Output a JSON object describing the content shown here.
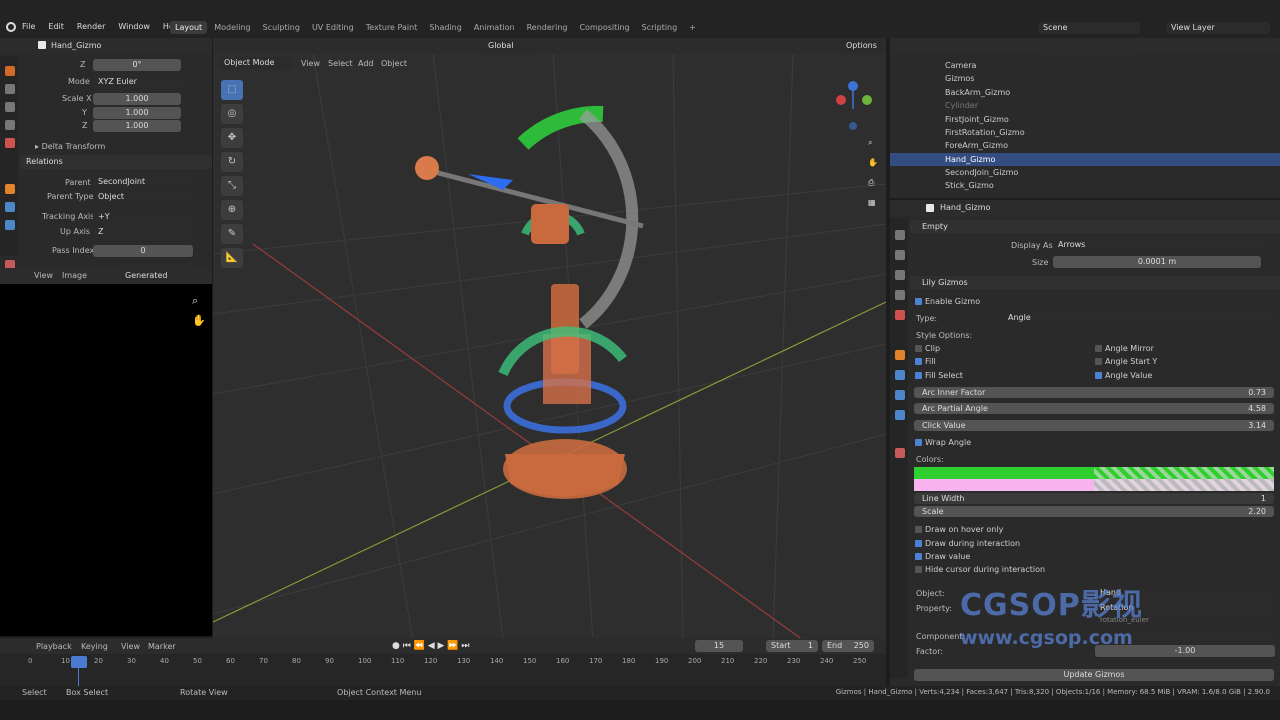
{
  "topbar": {
    "menus": [
      "File",
      "Edit",
      "Render",
      "Window",
      "Help"
    ],
    "workspaces": [
      "Layout",
      "Modeling",
      "Sculpting",
      "UV Editing",
      "Texture Paint",
      "Shading",
      "Animation",
      "Rendering",
      "Compositing",
      "Scripting"
    ],
    "scene": "Scene",
    "view_layer": "View Layer"
  },
  "props_left": {
    "object_name": "Hand_Gizmo",
    "z_rot": "0°",
    "mode_label": "Mode",
    "mode": "XYZ Euler",
    "scale_x_label": "Scale X",
    "scale_x": "1.000",
    "y_label": "Y",
    "scale_y": "1.000",
    "z_label": "Z",
    "scale_z": "1.000",
    "delta": "Delta Transform",
    "relations": "Relations",
    "parent_label": "Parent",
    "parent": "SecondJoint",
    "parent_type_label": "Parent Type",
    "parent_type": "Object",
    "tracking_label": "Tracking Axis",
    "tracking": "+Y",
    "up_label": "Up Axis",
    "up": "Z",
    "pass_label": "Pass Index",
    "pass": "0"
  },
  "image_editor": {
    "view": "View",
    "image": "Image",
    "name": "Generated Image"
  },
  "viewport": {
    "mode": "Object Mode",
    "menus": [
      "View",
      "Select",
      "Add",
      "Object"
    ],
    "orientation": "Global",
    "options": "Options"
  },
  "outliner": {
    "items": [
      "Camera",
      "Gizmos",
      "BackArm_Gizmo",
      "Cylinder",
      "FirstJoint_Gizmo",
      "FirstRotation_Gizmo",
      "ForeArm_Gizmo",
      "Hand_Gizmo",
      "SecondJoin_Gizmo",
      "Stick_Gizmo"
    ]
  },
  "props": {
    "object": "Hand_Gizmo",
    "empty": "Empty",
    "display_as_label": "Display As",
    "display_as": "Arrows",
    "size_label": "Size",
    "size": "0.0001 m",
    "lily": "Lily Gizmos",
    "enable": "Enable Gizmo",
    "type_label": "Type:",
    "type": "Angle",
    "style": "Style Options:",
    "clip": "Clip",
    "fill": "Fill",
    "fill_select": "Fill Select",
    "angle_mirror": "Angle Mirror",
    "angle_start_y": "Angle Start Y",
    "angle_value": "Angle Value",
    "arc_inner": "Arc Inner Factor",
    "arc_inner_v": "0.73",
    "arc_partial": "Arc Partial Angle",
    "arc_partial_v": "4.58",
    "click": "Click Value",
    "click_v": "3.14",
    "wrap": "Wrap Angle",
    "colors": "Colors:",
    "line_width": "Line Width",
    "line_width_v": "1",
    "scale": "Scale",
    "scale_v": "2.20",
    "hover": "Draw on hover only",
    "during": "Draw during interaction",
    "draw_value": "Draw value",
    "hide_cursor": "Hide cursor during interaction",
    "object_label": "Object:",
    "object_v": "Hand",
    "property_label": "Property:",
    "property_v": "Rotation",
    "property_sub": "rotation_euler",
    "component_label": "Component:",
    "factor_label": "Factor:",
    "factor_v": "-1.00",
    "update": "Update Gizmos",
    "green": "#2ecf2e",
    "pink": "#f6b3ee"
  },
  "timeline": {
    "playback": "Playback",
    "keying": "Keying",
    "view": "View",
    "marker": "Marker",
    "frame": "15",
    "start_label": "Start",
    "start": "1",
    "end_label": "End",
    "end": "250",
    "ticks": [
      "0",
      "10",
      "20",
      "30",
      "40",
      "50",
      "60",
      "70",
      "80",
      "90",
      "100",
      "110",
      "120",
      "130",
      "140",
      "150",
      "160",
      "170",
      "180",
      "190",
      "200",
      "210",
      "220",
      "230",
      "240",
      "250"
    ]
  },
  "statusbar": {
    "select": "Select",
    "box": "Box Select",
    "rotate": "Rotate View",
    "ctx": "Object Context Menu",
    "stats": "Gizmos | Hand_Gizmo | Verts:4,234 | Faces:3,647 | Tris:8,320 | Objects:1/16 | Memory: 68.5 MiB | VRAM: 1.6/8.0 GiB | 2.90.0"
  },
  "watermark": {
    "logo": "CGSOP影视",
    "url": "www.cgsop.com"
  }
}
